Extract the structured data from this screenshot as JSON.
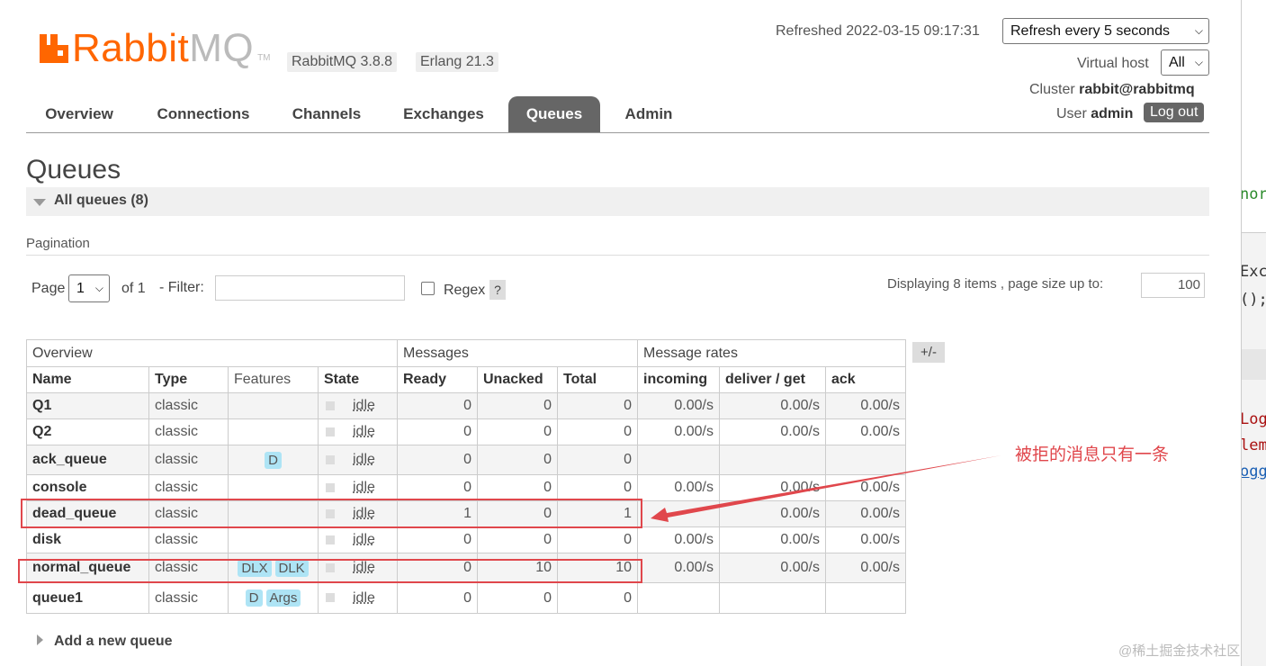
{
  "header": {
    "logo": {
      "rabbit": "Rabbit",
      "mq": "MQ",
      "tm": "TM"
    },
    "version_badges": [
      "RabbitMQ 3.8.8",
      "Erlang 21.3"
    ],
    "refreshed_label": "Refreshed 2022-03-15 09:17:31",
    "refresh_select": "Refresh every 5 seconds",
    "virtual_host_label": "Virtual host",
    "virtual_host_value": "All",
    "cluster_label": "Cluster",
    "cluster_value": "rabbit@rabbitmq",
    "user_label": "User",
    "user_value": "admin",
    "logout": "Log out"
  },
  "nav": {
    "tabs": [
      "Overview",
      "Connections",
      "Channels",
      "Exchanges",
      "Queues",
      "Admin"
    ],
    "active": "Queues"
  },
  "page": {
    "title": "Queues",
    "section": "All queues (8)",
    "pagination_label": "Pagination",
    "page_label": "Page",
    "page_value": "1",
    "of_label": "of 1",
    "filter_label": "- Filter:",
    "filter_value": "",
    "regex_label": "Regex",
    "help": "?",
    "displaying": "Displaying 8 items , page size up to:",
    "page_size": "100",
    "plus_minus": "+/-",
    "add_queue": "Add a new queue"
  },
  "table": {
    "groups": [
      "Overview",
      "Messages",
      "Message rates"
    ],
    "columns": [
      "Name",
      "Type",
      "Features",
      "State",
      "Ready",
      "Unacked",
      "Total",
      "incoming",
      "deliver / get",
      "ack"
    ],
    "rows": [
      {
        "name": "Q1",
        "type": "classic",
        "features": [],
        "state": "idle",
        "ready": "0",
        "unacked": "0",
        "total": "0",
        "incoming": "0.00/s",
        "deliver": "0.00/s",
        "ack": "0.00/s"
      },
      {
        "name": "Q2",
        "type": "classic",
        "features": [],
        "state": "idle",
        "ready": "0",
        "unacked": "0",
        "total": "0",
        "incoming": "0.00/s",
        "deliver": "0.00/s",
        "ack": "0.00/s"
      },
      {
        "name": "ack_queue",
        "type": "classic",
        "features": [
          "D"
        ],
        "state": "idle",
        "ready": "0",
        "unacked": "0",
        "total": "0",
        "incoming": "",
        "deliver": "",
        "ack": ""
      },
      {
        "name": "console",
        "type": "classic",
        "features": [],
        "state": "idle",
        "ready": "0",
        "unacked": "0",
        "total": "0",
        "incoming": "0.00/s",
        "deliver": "0.00/s",
        "ack": "0.00/s"
      },
      {
        "name": "dead_queue",
        "type": "classic",
        "features": [],
        "state": "idle",
        "ready": "1",
        "unacked": "0",
        "total": "1",
        "incoming": "",
        "deliver": "0.00/s",
        "ack": "0.00/s"
      },
      {
        "name": "disk",
        "type": "classic",
        "features": [],
        "state": "idle",
        "ready": "0",
        "unacked": "0",
        "total": "0",
        "incoming": "0.00/s",
        "deliver": "0.00/s",
        "ack": "0.00/s"
      },
      {
        "name": "normal_queue",
        "type": "classic",
        "features": [
          "DLX",
          "DLK"
        ],
        "state": "idle",
        "ready": "0",
        "unacked": "10",
        "total": "10",
        "incoming": "0.00/s",
        "deliver": "0.00/s",
        "ack": "0.00/s"
      },
      {
        "name": "queue1",
        "type": "classic",
        "features": [
          "D",
          "Args"
        ],
        "state": "idle",
        "ready": "0",
        "unacked": "0",
        "total": "0",
        "incoming": "",
        "deliver": "",
        "ack": ""
      }
    ]
  },
  "annotation": {
    "note": "被拒的消息只有一条",
    "color": "#e0474c"
  },
  "side_code": [
    "nore",
    "Exc",
    "();",
    "Log",
    "lem",
    "ogg"
  ],
  "watermark": "@稀土掘金技术社区"
}
